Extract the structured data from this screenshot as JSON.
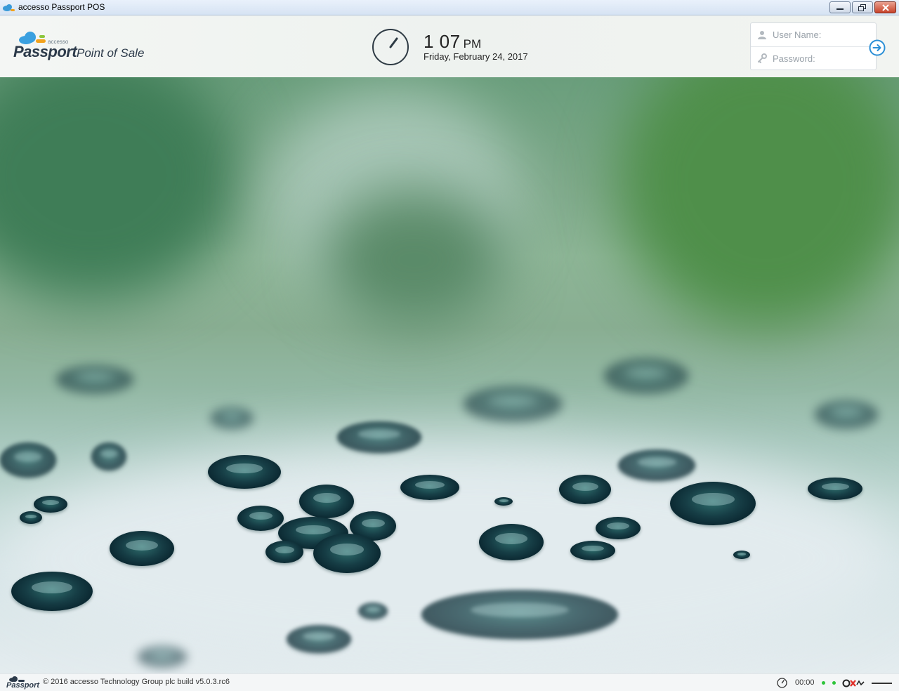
{
  "window": {
    "title": "accesso Passport POS"
  },
  "header": {
    "logo": {
      "small_text": "accesso",
      "brand": "Passport",
      "tagline": "Point of Sale"
    },
    "clock": {
      "time": "1 07",
      "ampm": "PM",
      "date": "Friday, February 24, 2017"
    },
    "login": {
      "username_placeholder": "User Name:",
      "password_placeholder": "Password:",
      "username_value": "",
      "password_value": ""
    }
  },
  "footer": {
    "brand": "Passport",
    "copyright": "© 2016 accesso Technology Group plc build v5.0.3.rc6",
    "timer": "00:00"
  },
  "colors": {
    "accent": "#2b8fd6",
    "status_green": "#2ec43a",
    "status_red": "#e0302a"
  },
  "icons": {
    "app": "cloud-icon",
    "clock": "clock-icon",
    "user": "user-icon",
    "password": "key-icon",
    "submit": "arrow-right-circle-icon"
  }
}
